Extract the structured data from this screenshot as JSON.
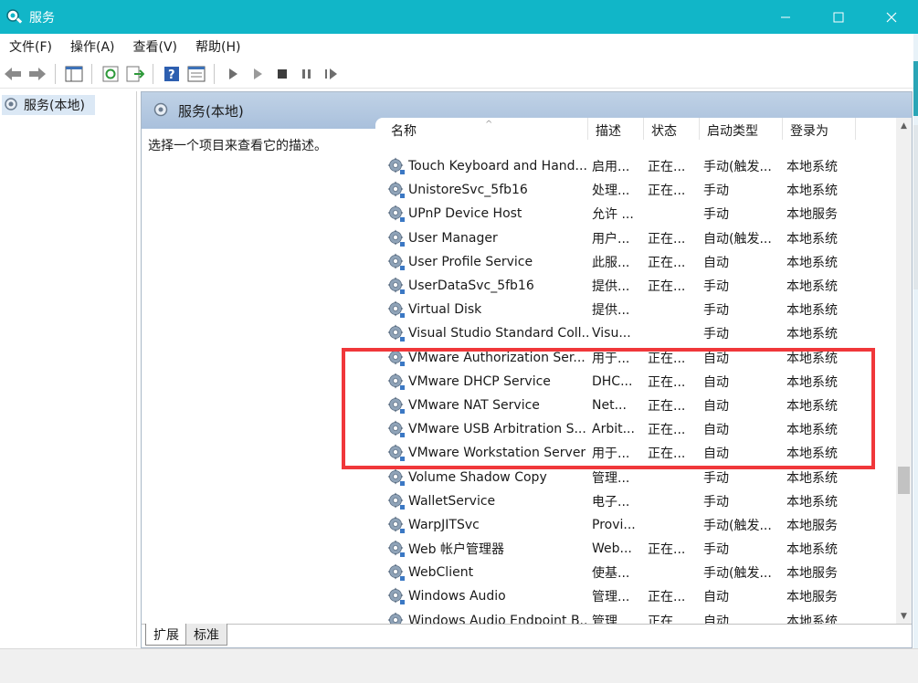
{
  "window": {
    "title": "服务",
    "controls": {
      "minimize": "minimize-icon",
      "maximize": "maximize-icon",
      "close": "close-icon"
    }
  },
  "menu": [
    "文件(F)",
    "操作(A)",
    "查看(V)",
    "帮助(H)"
  ],
  "toolbar": [
    "back-arrow-icon",
    "forward-arrow-icon",
    "console-tree-icon",
    "refresh-icon",
    "export-list-icon",
    "help-icon",
    "properties-icon",
    "play-icon",
    "play-alt-icon",
    "stop-icon",
    "pause-icon",
    "restart-icon"
  ],
  "tree": {
    "root_label": "服务(本地)"
  },
  "pane": {
    "header_title": "服务(本地)",
    "description_prompt": "选择一个项目来查看它的描述。"
  },
  "table": {
    "columns": [
      "名称",
      "描述",
      "状态",
      "启动类型",
      "登录为"
    ],
    "rows": [
      {
        "name": "Touch Keyboard and Hand...",
        "desc": "启用...",
        "status": "正在...",
        "start": "手动(触发...",
        "logon": "本地系统"
      },
      {
        "name": "UnistoreSvc_5fb16",
        "desc": "处理...",
        "status": "正在...",
        "start": "手动",
        "logon": "本地系统"
      },
      {
        "name": "UPnP Device Host",
        "desc": "允许 ...",
        "status": "",
        "start": "手动",
        "logon": "本地服务"
      },
      {
        "name": "User Manager",
        "desc": "用户...",
        "status": "正在...",
        "start": "自动(触发...",
        "logon": "本地系统"
      },
      {
        "name": "User Profile Service",
        "desc": "此服...",
        "status": "正在...",
        "start": "自动",
        "logon": "本地系统"
      },
      {
        "name": "UserDataSvc_5fb16",
        "desc": "提供...",
        "status": "正在...",
        "start": "手动",
        "logon": "本地系统"
      },
      {
        "name": "Virtual Disk",
        "desc": "提供...",
        "status": "",
        "start": "手动",
        "logon": "本地系统"
      },
      {
        "name": "Visual Studio Standard Coll...",
        "desc": "Visu...",
        "status": "",
        "start": "手动",
        "logon": "本地系统"
      },
      {
        "name": "VMware Authorization Ser...",
        "desc": "用于...",
        "status": "正在...",
        "start": "自动",
        "logon": "本地系统"
      },
      {
        "name": "VMware DHCP Service",
        "desc": "DHC...",
        "status": "正在...",
        "start": "自动",
        "logon": "本地系统"
      },
      {
        "name": "VMware NAT Service",
        "desc": "Net...",
        "status": "正在...",
        "start": "自动",
        "logon": "本地系统"
      },
      {
        "name": "VMware USB Arbitration S...",
        "desc": "Arbit...",
        "status": "正在...",
        "start": "自动",
        "logon": "本地系统"
      },
      {
        "name": "VMware Workstation Server",
        "desc": "用于...",
        "status": "正在...",
        "start": "自动",
        "logon": "本地系统"
      },
      {
        "name": "Volume Shadow Copy",
        "desc": "管理...",
        "status": "",
        "start": "手动",
        "logon": "本地系统"
      },
      {
        "name": "WalletService",
        "desc": "电子...",
        "status": "",
        "start": "手动",
        "logon": "本地系统"
      },
      {
        "name": "WarpJITSvc",
        "desc": "Provi...",
        "status": "",
        "start": "手动(触发...",
        "logon": "本地服务"
      },
      {
        "name": "Web 帐户管理器",
        "desc": "Web...",
        "status": "正在...",
        "start": "手动",
        "logon": "本地系统"
      },
      {
        "name": "WebClient",
        "desc": "使基...",
        "status": "",
        "start": "手动(触发...",
        "logon": "本地服务"
      },
      {
        "name": "Windows Audio",
        "desc": "管理...",
        "status": "正在...",
        "start": "自动",
        "logon": "本地服务"
      },
      {
        "name": "Windows Audio Endpoint B...",
        "desc": "管理...",
        "status": "正在...",
        "start": "自动",
        "logon": "本地系统"
      }
    ]
  },
  "tabs": [
    "扩展",
    "标准"
  ],
  "colors": {
    "titlebar": "#11b6c8",
    "highlight": "#f0373a",
    "pane_header": "#b6c9e0"
  }
}
